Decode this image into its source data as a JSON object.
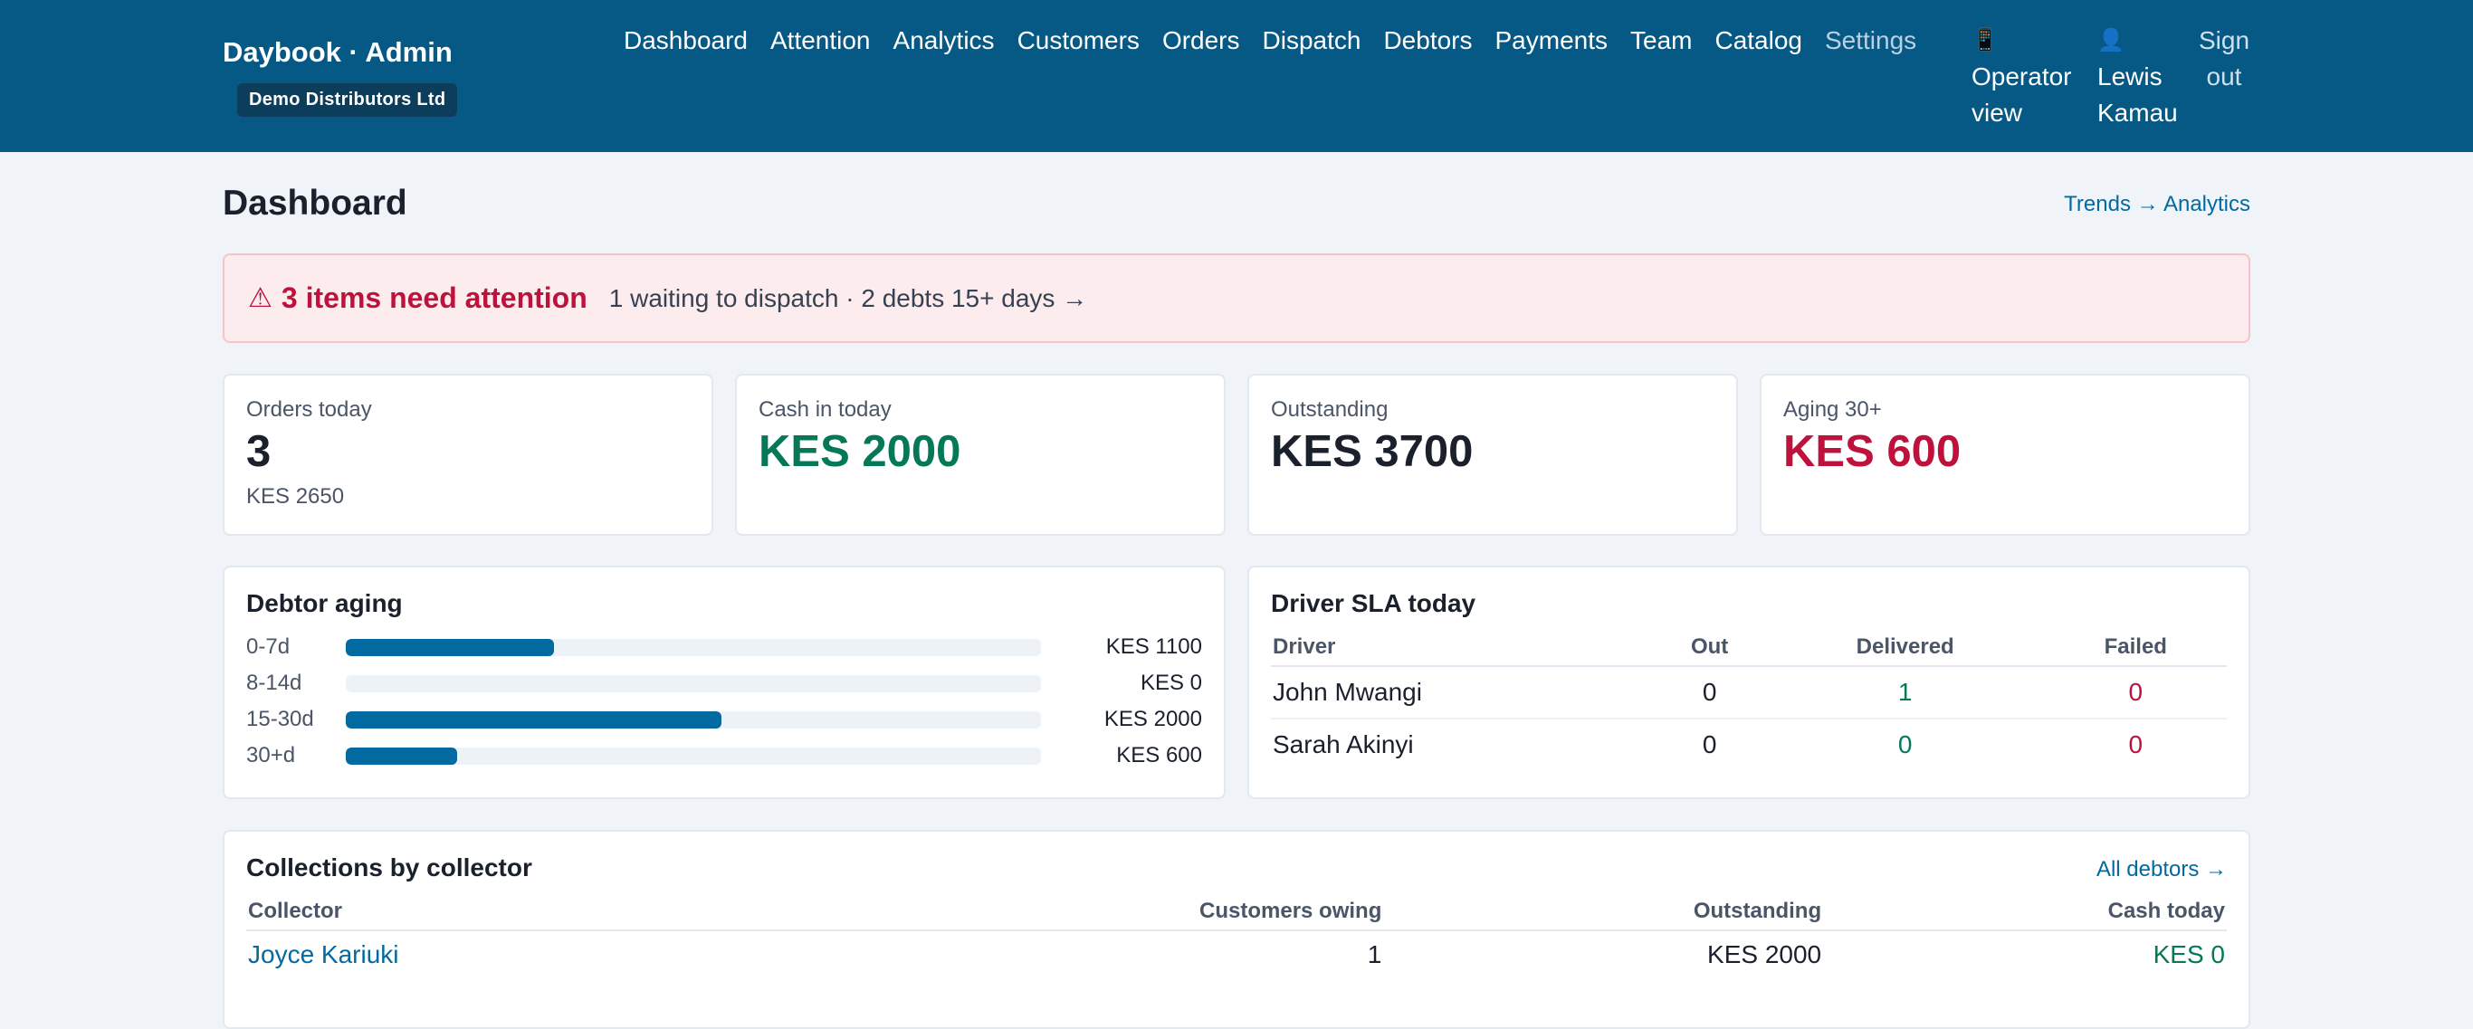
{
  "header": {
    "brand": "Daybook · Admin",
    "org": "Demo Distributors Ltd",
    "nav": [
      "Dashboard",
      "Attention",
      "Analytics",
      "Customers",
      "Orders",
      "Dispatch",
      "Debtors",
      "Payments",
      "Team",
      "Catalog",
      "Settings"
    ],
    "operator_view": "Operator view",
    "user_name": "Lewis Kamau",
    "sign_out": "Sign out"
  },
  "page": {
    "title": "Dashboard",
    "trends_link": "Trends → Analytics"
  },
  "alert": {
    "icon": "warning-icon",
    "title": "3 items need attention",
    "detail": "1 waiting to dispatch · 2 debts 15+ days →"
  },
  "stats": [
    {
      "label": "Orders today",
      "value": "3",
      "sub": "KES 2650"
    },
    {
      "label": "Cash in today",
      "value": "KES 2000"
    },
    {
      "label": "Outstanding",
      "value": "KES 3700"
    },
    {
      "label": "Aging 30+",
      "value": "KES 600"
    }
  ],
  "debtor_aging": {
    "title": "Debtor aging",
    "rows": [
      {
        "label": "0-7d",
        "value": "KES 1100",
        "fraction": 0.3
      },
      {
        "label": "8-14d",
        "value": "KES 0",
        "fraction": 0
      },
      {
        "label": "15-30d",
        "value": "KES 2000",
        "fraction": 0.54
      },
      {
        "label": "30+d",
        "value": "KES 600",
        "fraction": 0.16
      }
    ]
  },
  "driver_sla": {
    "title": "Driver SLA today",
    "columns": [
      "Driver",
      "Out",
      "Delivered",
      "Failed"
    ],
    "rows": [
      {
        "driver": "John Mwangi",
        "out": "0",
        "delivered": "1",
        "failed": "0"
      },
      {
        "driver": "Sarah Akinyi",
        "out": "0",
        "delivered": "0",
        "failed": "0"
      }
    ]
  },
  "collections": {
    "title": "Collections by collector",
    "all_link": "All debtors →",
    "columns": [
      "Collector",
      "Customers owing",
      "Outstanding",
      "Cash today"
    ],
    "rows": [
      {
        "collector": "Joyce Kariuki",
        "owing": "1",
        "outstanding": "KES 2000",
        "cash": "KES 0"
      }
    ]
  },
  "colors": {
    "header": "#075985",
    "accent": "#0369a1",
    "positive": "#047857",
    "negative": "#be123c"
  }
}
